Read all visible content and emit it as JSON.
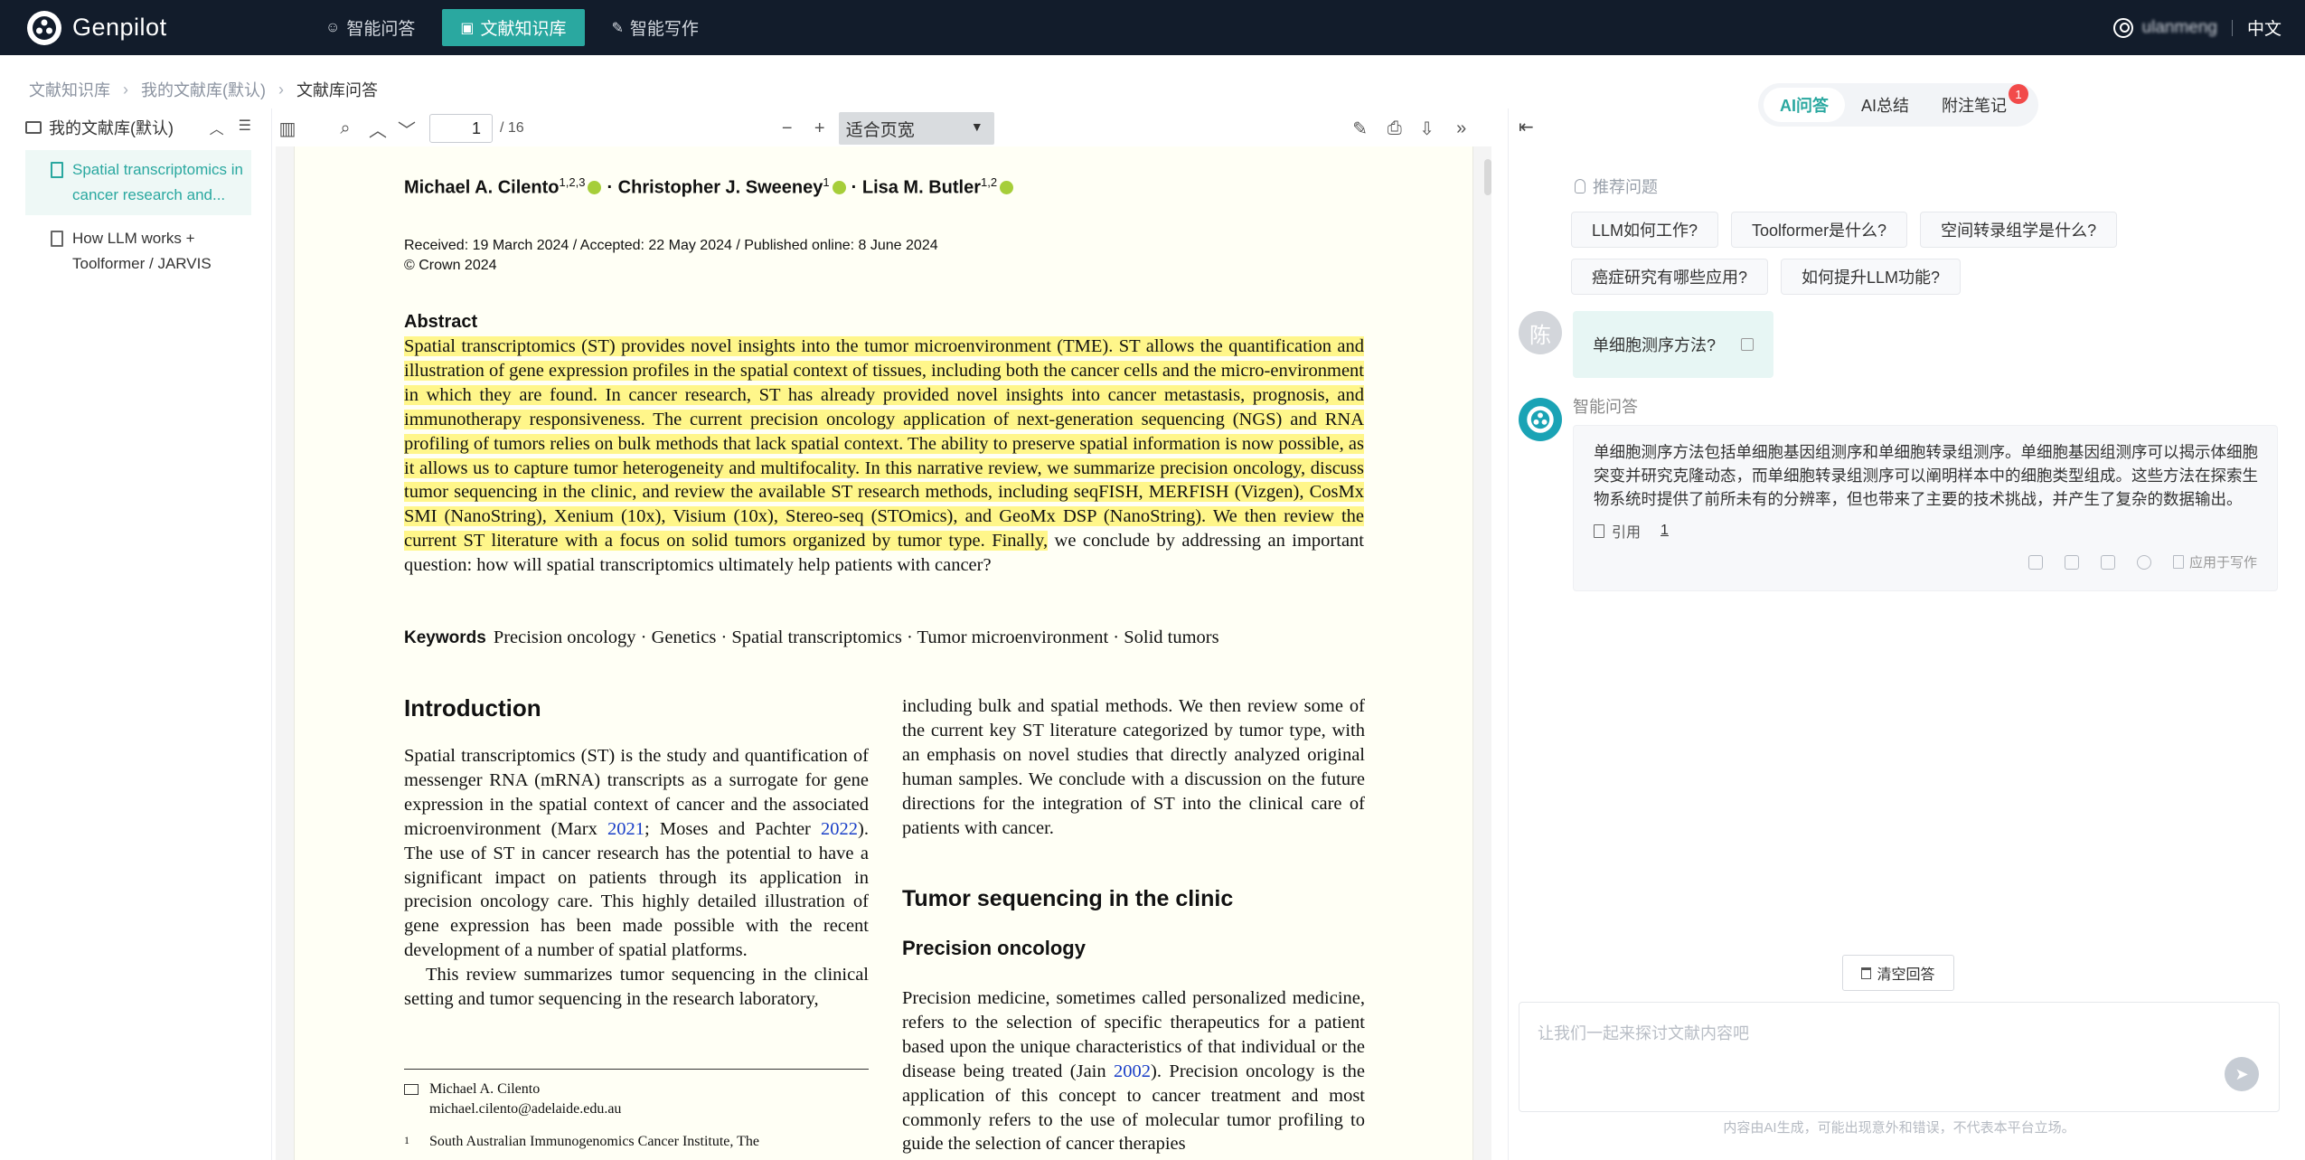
{
  "app": {
    "name": "Genpilot",
    "language": "中文",
    "user": "ulanmeng"
  },
  "nav": {
    "tabs": [
      {
        "label": "智能问答",
        "icon": "chat-icon"
      },
      {
        "label": "文献知识库",
        "icon": "library-icon",
        "active": true
      },
      {
        "label": "智能写作",
        "icon": "write-icon"
      }
    ]
  },
  "breadcrumb": [
    "文献知识库",
    "我的文献库(默认)",
    "文献库问答"
  ],
  "sidebar": {
    "title": "我的文献库(默认)",
    "items": [
      {
        "label": "Spatial transcriptomics in cancer research and...",
        "active": true
      },
      {
        "label": "How LLM works + Toolformer / JARVIS"
      }
    ]
  },
  "pdf_toolbar": {
    "page": "1",
    "total": "/ 16",
    "zoom": "适合页宽"
  },
  "pdf": {
    "authors": [
      {
        "name": "Michael A. Cilento",
        "sup": "1,2,3"
      },
      {
        "name": "Christopher J. Sweeney",
        "sup": "1"
      },
      {
        "name": "Lisa M. Butler",
        "sup": "1,2"
      }
    ],
    "received": "Received: 19 March 2024 / Accepted: 22 May 2024 / Published online: 8 June 2024",
    "copyright": "© Crown 2024",
    "abstract_title": "Abstract",
    "abstract_highlighted": "Spatial transcriptomics (ST) provides novel insights into the tumor microenvironment (TME). ST allows the quantification and illustration of gene expression profiles in the spatial context of tissues, including both the cancer cells and the micro-environment in which they are found. In cancer research, ST has already provided novel insights into cancer metastasis, prognosis, and immunotherapy responsiveness. The current precision oncology application of next-generation sequencing (NGS) and RNA profiling of tumors relies on bulk methods that lack spatial context. The ability to preserve spatial information is now possible, as it allows us to capture tumor heterogeneity and multifocality. In this narrative review, we summarize precision oncology, discuss tumor sequencing in the clinic, and review the available ST research methods, including seqFISH, MERFISH (Vizgen), CosMx SMI (NanoString), Xenium (10x), Visium (10x), Stereo-seq (STOmics), and GeoMx DSP (NanoString). We then review the current ST literature with a focus on solid tumors organized by tumor type. Finally,",
    "abstract_rest": " we conclude by addressing an important question: how will spatial transcriptomics ultimately help patients with cancer?",
    "keywords_label": "Keywords",
    "keywords": "Precision oncology · Genetics · Spatial transcriptomics · Tumor microenvironment · Solid tumors",
    "intro_title": "Introduction",
    "intro_p1_a": "Spatial transcriptomics (ST) is the study and quantification of messenger RNA (mRNA) transcripts as a surrogate for gene expression in the spatial context of cancer and the associated microenvironment (Marx ",
    "intro_cite1": "2021",
    "intro_p1_b": "; Moses and Pachter ",
    "intro_cite2": "2022",
    "intro_p1_c": "). The use of ST in cancer research has the potential to have a significant impact on patients through its application in precision oncology care. This highly detailed illustration of gene expression has been made possible with the recent development of a number of spatial platforms.",
    "intro_p2": "This review summarizes tumor sequencing in the clinical setting and tumor sequencing in the research laboratory,",
    "right_p1": "including bulk and spatial methods. We then review some of the current key ST literature categorized by tumor type, with an emphasis on novel studies that directly analyzed original human samples. We conclude with a discussion on the future directions for the integration of ST into the clinical care of patients with cancer.",
    "tumor_title": "Tumor sequencing in the clinic",
    "precision_title": "Precision oncology",
    "right_p2_a": "Precision medicine, sometimes called personalized medicine, refers to the selection of specific therapeutics for a patient based upon the unique characteristics of that individual or the disease being treated (Jain ",
    "right_cite": "2002",
    "right_p2_b": "). Precision oncology is the application of this concept to cancer treatment and most commonly refers to the use of molecular tumor profiling to guide the selection of cancer therapies",
    "footnote_name": "Michael A. Cilento",
    "footnote_email": "michael.cilento@adelaide.edu.au",
    "footnote_num": "1",
    "footnote_affil": "South Australian Immunogenomics Cancer Institute, The"
  },
  "right_panel": {
    "tabs": [
      {
        "label": "AI问答",
        "active": true
      },
      {
        "label": "AI总结"
      },
      {
        "label": "附注笔记",
        "badge": "1"
      }
    ],
    "recommend_label": "推荐问题",
    "chips": [
      "LLM如何工作?",
      "Toolformer是什么?",
      "空间转录组学是什么?",
      "癌症研究有哪些应用?",
      "如何提升LLM功能?"
    ],
    "user_avatar": "陈",
    "question": "单细胞测序方法?",
    "ai_name": "智能问答",
    "answer": "单细胞测序方法包括单细胞基因组测序和单细胞转录组测序。单细胞基因组测序可以揭示体细胞突变并研究克隆动态，而单细胞转录组测序可以阐明样本中的细胞类型组成。这些方法在探索生物系统时提供了前所未有的分辨率，但也带来了主要的技术挑战，并产生了复杂的数据输出。",
    "cite_label": "引用",
    "cite_count": "1",
    "apply_label": "应用于写作",
    "clear_label": "清空回答",
    "input_placeholder": "让我们一起来探讨文献内容吧",
    "disclaimer": "内容由AI生成，可能出现意外和错误，不代表本平台立场。"
  },
  "colors": {
    "nav_bg": "#121c2b",
    "accent": "#2aa8a0",
    "highlight": "#fff68a",
    "badge": "#f24a4a"
  }
}
